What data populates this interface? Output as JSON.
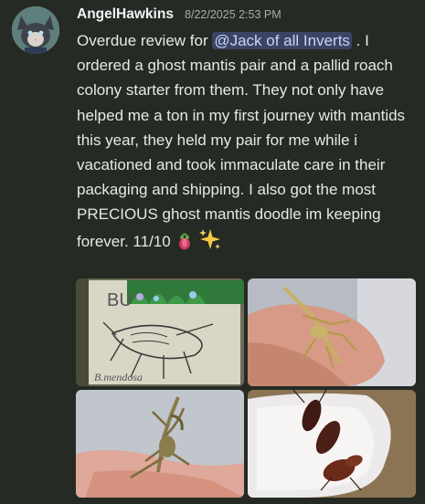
{
  "user": {
    "name": "AngelHawkins",
    "timestamp": "8/22/2025 2:53 PM"
  },
  "message": {
    "text_before": "Overdue review for ",
    "mention": "@Jack of all Inverts",
    "text_after": " . I ordered a ghost mantis pair and a pallid roach colony starter from them. They not only have helped me a ton in my first journey with mantids this year, they held my pair for me while i vacationed and took immaculate care in their packaging and shipping. I also got the most PRECIOUS ghost mantis doodle im keeping forever. 11/10",
    "emojis": [
      "mantis-emoji",
      "sparkles-emoji"
    ]
  },
  "attachments": [
    {
      "icon": "mantis-doodle-photo",
      "caption": "BU"
    },
    {
      "icon": "ghost-mantis-on-finger-photo"
    },
    {
      "icon": "ghost-mantis-on-hand-photo"
    },
    {
      "icon": "roaches-on-paper-towel-photo"
    }
  ],
  "colors": {
    "background": "#262a24",
    "mention_bg": "#3b4462",
    "mention_text": "#c9d2ff",
    "username": "#f2f3f5",
    "timestamp": "#a8aaa6"
  }
}
